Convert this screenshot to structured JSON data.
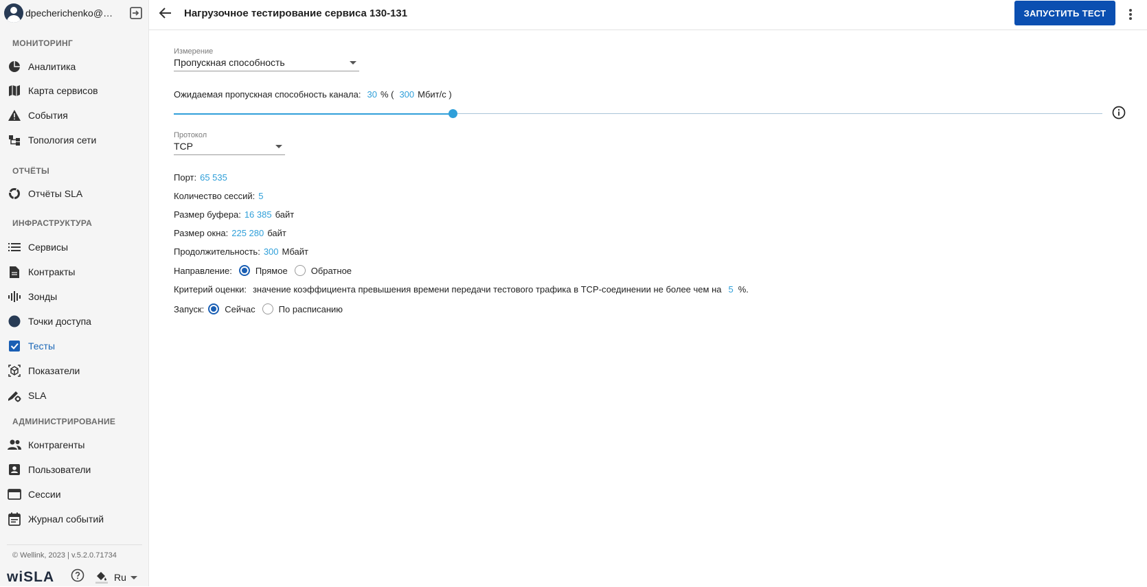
{
  "sidebar": {
    "user": {
      "name": "dpecherichenko@wellink.ru"
    },
    "sections": {
      "monitoring": "МОНИТОРИНГ",
      "reports": "ОТЧЁТЫ",
      "infrastructure": "ИНФРАСТРУКТУРА",
      "administration": "АДМИНИСТРИРОВАНИЕ"
    },
    "items": {
      "analytics": "Аналитика",
      "service_map": "Карта сервисов",
      "events": "События",
      "topology": "Топология сети",
      "sla_reports": "Отчёты SLA",
      "services": "Сервисы",
      "contracts": "Контракты",
      "probes": "Зонды",
      "access_points": "Точки доступа",
      "tests": "Тесты",
      "indicators": "Показатели",
      "sla": "SLA",
      "counterparties": "Контрагенты",
      "users": "Пользователи",
      "sessions": "Сессии",
      "event_log": "Журнал событий"
    },
    "active_item": "tests",
    "copyright": "© Wellink, 2023 | v.5.2.0.71734",
    "logo": "wiSLA",
    "language": "Ru"
  },
  "header": {
    "title": "Нагрузочное тестирование сервиса 130-131",
    "run_button": "ЗАПУСТИТЬ ТЕСТ"
  },
  "form": {
    "measurement": {
      "label": "Измерение",
      "value": "Пропускная способность"
    },
    "bandwidth": {
      "label": "Ожидаемая пропускная способность канала:",
      "percent": "30",
      "percent_suffix": "% (",
      "mbps": "300",
      "mbps_suffix": "Мбит/с )",
      "slider_fraction": 0.3
    },
    "protocol": {
      "label": "Протокол",
      "value": "TCP"
    },
    "port": {
      "label": "Порт:",
      "value": "65 535"
    },
    "sessions": {
      "label": "Количество сессий:",
      "value": "5"
    },
    "buffer_size": {
      "label": "Размер буфера:",
      "value": "16 385",
      "unit": "байт"
    },
    "window_size": {
      "label": "Размер окна:",
      "value": "225 280",
      "unit": "байт"
    },
    "duration": {
      "label": "Продолжительность:",
      "value": "300",
      "unit": "Мбайт"
    },
    "direction": {
      "label": "Направление:",
      "options": [
        "Прямое",
        "Обратное"
      ],
      "selected": "Прямое"
    },
    "criterion": {
      "label": "Критерий оценки:",
      "text": "значение коэффициента превышения времени передачи тестового трафика в TCP-соединении не более чем на",
      "value": "5",
      "suffix": "%."
    },
    "launch": {
      "label": "Запуск:",
      "options": [
        "Сейчас",
        "По расписанию"
      ],
      "selected": "Сейчас"
    }
  },
  "colors": {
    "accent": "#2f9fd9",
    "primary_button": "#0b4fb1",
    "radio_checked": "#1a5fb4",
    "sidebar_bg": "#f5f5f5"
  }
}
